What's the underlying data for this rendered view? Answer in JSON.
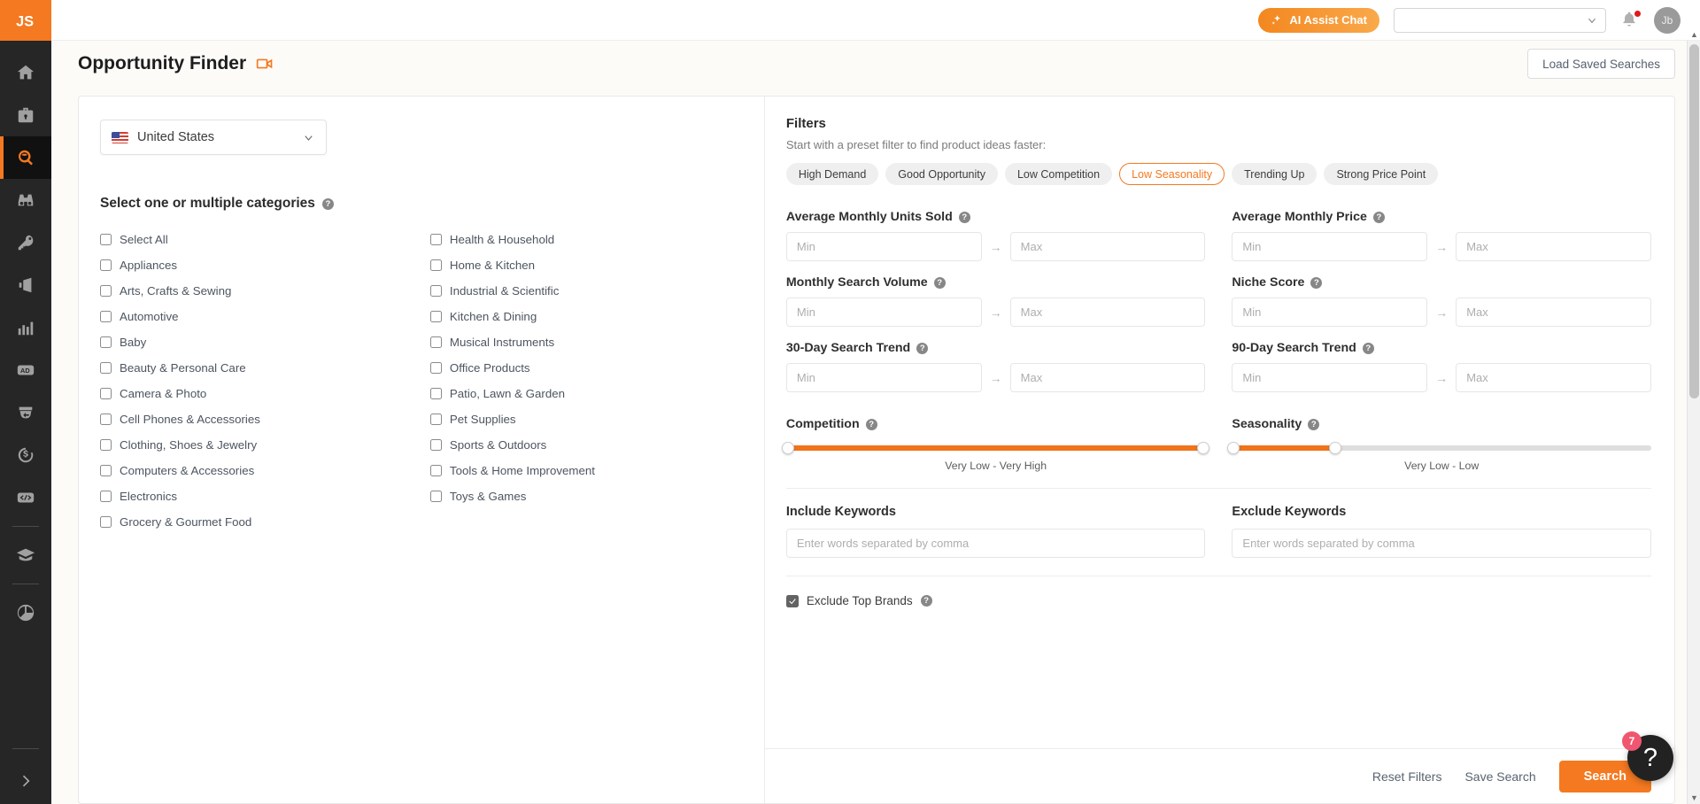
{
  "sidebar": {
    "logo_text": "JS",
    "items": [
      {
        "name": "home",
        "icon": "home-icon",
        "active": false
      },
      {
        "name": "product-database",
        "icon": "briefcase-icon",
        "active": false
      },
      {
        "name": "opportunity-finder",
        "icon": "magnifier-icon",
        "active": true
      },
      {
        "name": "product-tracker",
        "icon": "binoculars-icon",
        "active": false
      },
      {
        "name": "keyword-scout",
        "icon": "key-icon",
        "active": false
      },
      {
        "name": "marketing",
        "icon": "megaphone-icon",
        "active": false
      },
      {
        "name": "analytics",
        "icon": "bar-chart-icon",
        "active": false
      },
      {
        "name": "advertising",
        "icon": "ad-icon",
        "active": false
      },
      {
        "name": "inventory",
        "icon": "box-refresh-icon",
        "active": false
      },
      {
        "name": "finance",
        "icon": "dollar-refresh-icon",
        "active": false
      },
      {
        "name": "developer",
        "icon": "code-icon",
        "active": false
      },
      {
        "name": "academy",
        "icon": "graduation-cap-icon",
        "active": false
      },
      {
        "name": "extension",
        "icon": "pie-icon",
        "active": false
      }
    ],
    "expand_icon": "chevron-right-icon"
  },
  "topbar": {
    "ai_chat_label": "AI Assist Chat",
    "ai_chat_icon": "sparkle-icon",
    "account_select_value": "",
    "notification_icon": "bell-icon",
    "avatar_initials": "Jb"
  },
  "header": {
    "title": "Opportunity Finder",
    "video_icon": "video-camera-icon",
    "load_saved_label": "Load Saved Searches"
  },
  "left_panel": {
    "country": {
      "label": "United States",
      "flag_icon": "us-flag-icon",
      "chevron_icon": "chevron-down-icon"
    },
    "categories_title": "Select one or multiple categories",
    "categories_help_icon": "help-icon",
    "categories_left": [
      "Select All",
      "Appliances",
      "Arts, Crafts & Sewing",
      "Automotive",
      "Baby",
      "Beauty & Personal Care",
      "Camera & Photo",
      "Cell Phones & Accessories",
      "Clothing, Shoes & Jewelry",
      "Computers & Accessories",
      "Electronics",
      "Grocery & Gourmet Food"
    ],
    "categories_right": [
      "Health & Household",
      "Home & Kitchen",
      "Industrial & Scientific",
      "Kitchen & Dining",
      "Musical Instruments",
      "Office Products",
      "Patio, Lawn & Garden",
      "Pet Supplies",
      "Sports & Outdoors",
      "Tools & Home Improvement",
      "Toys & Games"
    ]
  },
  "filters": {
    "title": "Filters",
    "subtitle": "Start with a preset filter to find product ideas faster:",
    "presets": [
      {
        "label": "High Demand",
        "selected": false
      },
      {
        "label": "Good Opportunity",
        "selected": false
      },
      {
        "label": "Low Competition",
        "selected": false
      },
      {
        "label": "Low Seasonality",
        "selected": true
      },
      {
        "label": "Trending Up",
        "selected": false
      },
      {
        "label": "Strong Price Point",
        "selected": false
      }
    ],
    "range_fields": [
      {
        "label": "Average Monthly Units Sold",
        "min_value": "",
        "max_value": "",
        "min_placeholder": "Min",
        "max_placeholder": "Max"
      },
      {
        "label": "Average Monthly Price",
        "min_value": "",
        "max_value": "",
        "min_placeholder": "Min",
        "max_placeholder": "Max"
      },
      {
        "label": "Monthly Search Volume",
        "min_value": "",
        "max_value": "",
        "min_placeholder": "Min",
        "max_placeholder": "Max"
      },
      {
        "label": "Niche Score",
        "min_value": "",
        "max_value": "",
        "min_placeholder": "Min",
        "max_placeholder": "Max"
      },
      {
        "label": "30-Day Search Trend",
        "min_value": "",
        "max_value": "",
        "min_placeholder": "Min",
        "max_placeholder": "Max"
      },
      {
        "label": "90-Day Search Trend",
        "min_value": "",
        "max_value": "",
        "min_placeholder": "Min",
        "max_placeholder": "Max"
      }
    ],
    "sliders": [
      {
        "label": "Competition",
        "caption": "Very Low  -  Very High",
        "left_pct": 0,
        "right_pct": 100
      },
      {
        "label": "Seasonality",
        "caption": "Very Low  -  Low",
        "left_pct": 0,
        "right_pct": 25
      }
    ],
    "include_keywords": {
      "label": "Include Keywords",
      "value": "",
      "placeholder": "Enter words separated by comma"
    },
    "exclude_keywords": {
      "label": "Exclude Keywords",
      "value": "",
      "placeholder": "Enter words separated by comma"
    },
    "exclude_top_brands": {
      "label": "Exclude Top Brands",
      "checked": true,
      "help_icon": "help-icon"
    },
    "actions": {
      "reset_label": "Reset Filters",
      "save_label": "Save Search",
      "search_label": "Search"
    }
  },
  "help_fab": {
    "icon": "question-mark-icon",
    "badge_count": "7"
  },
  "colors": {
    "accent": "#f47920",
    "sidebar_bg": "#262626",
    "badge_red": "#f0566f"
  }
}
